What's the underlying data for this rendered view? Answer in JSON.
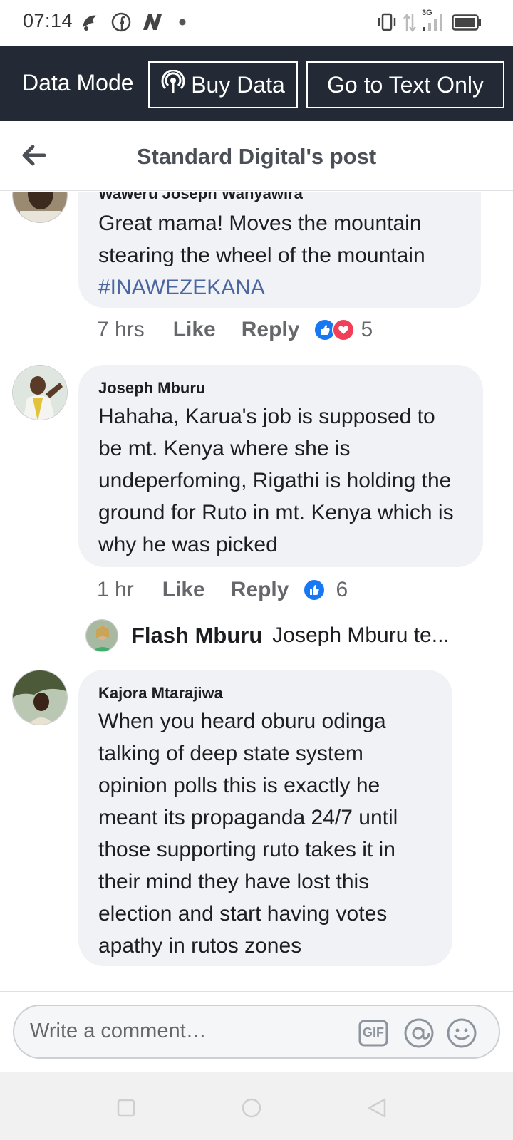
{
  "status_bar": {
    "time": "07:14",
    "network": "3G"
  },
  "data_bar": {
    "mode_label": "Data Mode",
    "buy_label": "Buy Data",
    "text_only_label": "Go to Text Only"
  },
  "header": {
    "title": "Standard Digital's post"
  },
  "comments": [
    {
      "author": "Waweru Joseph Wanyawira",
      "text": "Great mama! Moves the mountain stearing the wheel of the mountain",
      "hashtag": "#INAWEZEKANA",
      "time": "7 hrs",
      "like_label": "Like",
      "reply_label": "Reply",
      "reactions": [
        "like",
        "love"
      ],
      "reaction_count": "5"
    },
    {
      "author": "Joseph Mburu",
      "text": "Hahaha, Karua's job is supposed to be mt. Kenya where she is undeperfoming, Rigathi is holding the ground for Ruto in mt. Kenya which is why he was picked",
      "time": "1 hr",
      "like_label": "Like",
      "reply_label": "Reply",
      "reactions": [
        "like"
      ],
      "reaction_count": "6",
      "reply_preview": {
        "name": "Flash Mburu",
        "snippet": "Joseph Mburu te..."
      }
    },
    {
      "author": "Kajora Mtarajiwa",
      "text": "When you heard oburu odinga talking of deep state system opinion polls this is exactly he meant its propaganda 24/7 until those supporting ruto takes it in their mind they have lost this election and start having votes apathy in rutos zones"
    }
  ],
  "composer": {
    "placeholder": "Write a comment…",
    "gif_label": "GIF"
  },
  "colors": {
    "data_bar_bg": "#232a35",
    "bubble_bg": "#f0f2f5",
    "hashtag": "#4b67a1",
    "like_blue": "#1877f2",
    "love_red": "#f33e58"
  }
}
